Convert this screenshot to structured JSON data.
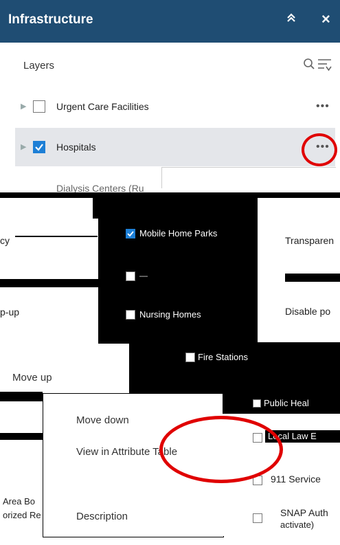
{
  "header": {
    "title": "Infrastructure",
    "collapse_icon": "double-chevron-up-icon",
    "close_icon": "close-icon",
    "close_glyph": "×"
  },
  "layers_bar": {
    "label": "Layers",
    "search_icon": "search-icon",
    "filter_icon": "filter-list-icon"
  },
  "layers": [
    {
      "label": "Urgent Care Facilities",
      "checked": false
    },
    {
      "label": "Hospitals",
      "checked": true
    },
    {
      "label": "Dialysis Centers (Ru"
    }
  ],
  "options_glyph": "•••",
  "left_menu_fragments": [
    "cy",
    "p-up",
    "Move up",
    "Area Bo",
    "orized Re"
  ],
  "sublayers": [
    "Mobile Home Parks",
    "Nursing Homes",
    "Fire Stations",
    "Public Heal",
    "Local Law E",
    "911 Service",
    "SNAP Auth",
    "activate)"
  ],
  "right_menu_fragments": [
    "Transparen",
    "Disable po"
  ],
  "context_menu": [
    "Move down",
    "View in Attribute Table",
    "Description"
  ],
  "accent_color": "#e00000",
  "header_color": "#1f4d73",
  "check_color": "#1d7fd6"
}
